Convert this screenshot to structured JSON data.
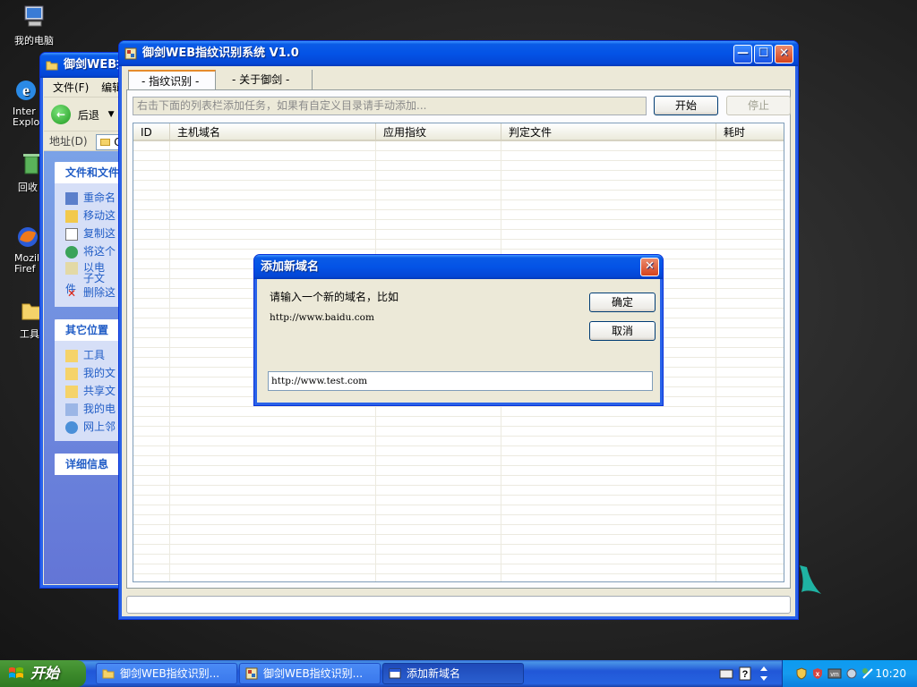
{
  "desktop": {
    "icons": [
      {
        "label": "我的电脑"
      },
      {
        "label": "Inter Explo"
      },
      {
        "label": "回收"
      },
      {
        "label": "Mozil Firef"
      },
      {
        "label": "工具"
      }
    ]
  },
  "explorer": {
    "title": "御剑WEB指",
    "menu_file": "文件(F)",
    "menu_edit": "编辑",
    "back_label": "后退",
    "address_label": "地址(D)",
    "address_value": "C:",
    "pane_file_tasks": "文件和文件",
    "file_tasks": [
      "重命名",
      "移动这",
      "复制这",
      "将这个",
      "以电子文件",
      "删除这"
    ],
    "pane_other": "其它位置",
    "other_places": [
      "工具",
      "我的文",
      "共享文",
      "我的电",
      "网上邻"
    ],
    "pane_details": "详细信息"
  },
  "main": {
    "title": "御剑WEB指纹识别系统 V1.0",
    "tabs": [
      {
        "label": "- 指纹识别 -"
      },
      {
        "label": "- 关于御剑 -"
      }
    ],
    "hint_text": "右击下面的列表栏添加任务，如果有自定义目录请手动添加...",
    "start_button": "开始",
    "stop_button": "停止",
    "columns": [
      "ID",
      "主机域名",
      "应用指纹",
      "判定文件",
      "耗时"
    ]
  },
  "dialog": {
    "title": "添加新域名",
    "prompt": "请输入一个新的域名，比如",
    "example": "http://www.baidu.com",
    "input_value": "http://www.test.com",
    "ok_button": "确定",
    "cancel_button": "取消"
  },
  "taskbar": {
    "start_label": "开始",
    "tasks": [
      {
        "label": "御剑WEB指纹识别..."
      },
      {
        "label": "御剑WEB指纹识别..."
      },
      {
        "label": "添加新域名"
      }
    ],
    "clock": "10:20"
  },
  "colors": {
    "title_blue": "#0453e6",
    "start_green": "#3c8a2b",
    "tray_blue": "#159bef",
    "window_face": "#ece9d8"
  }
}
